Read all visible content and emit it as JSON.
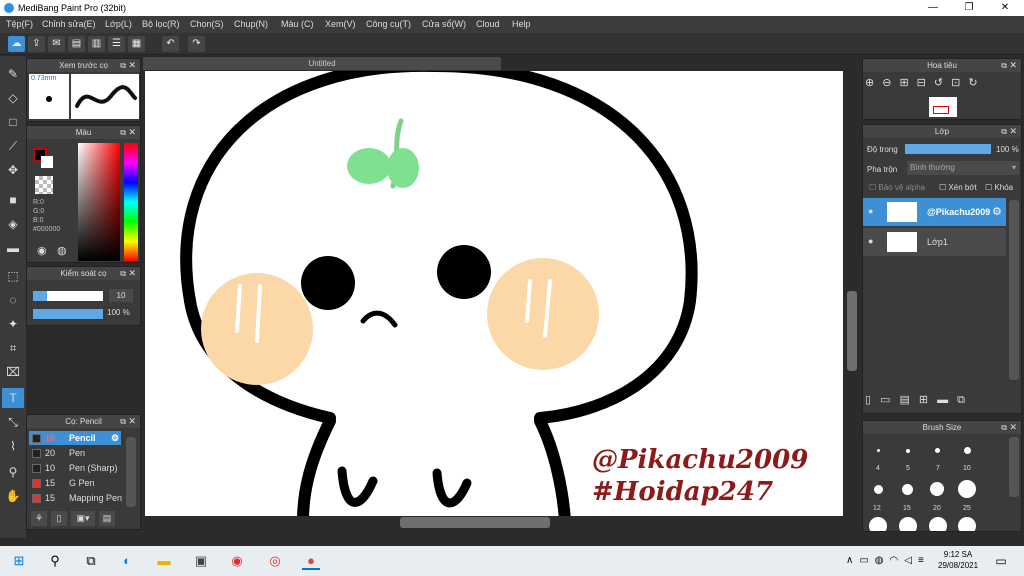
{
  "window": {
    "title": "MediBang Paint Pro (32bit)",
    "min": "—",
    "max": "❐",
    "close": "✕"
  },
  "menu": [
    "Tệp(F)",
    "Chỉnh sửa(E)",
    "Lớp(L)",
    "Bộ lọc(R)",
    "Chọn(S)",
    "Chụp(N)",
    "Màu (C)",
    "Xem(V)",
    "Công cụ(T)",
    "Cửa sổ(W)",
    "Cloud",
    "Help"
  ],
  "toolbar": {
    "icons": [
      "cloud-icon",
      "upload-icon",
      "chat-icon",
      "comment-icon",
      "page-icon",
      "list-icon",
      "grid-icon",
      "undo-icon",
      "redo-icon"
    ]
  },
  "preview_panel": {
    "title": "Xem trước cọ",
    "size": "0.73mm"
  },
  "color_panel": {
    "title": "Màu",
    "r": "R:0",
    "g": "G:0",
    "b": "B:0",
    "hex": "#000000",
    "primary": "#000000",
    "secondary": "#ffffff"
  },
  "control_panel": {
    "title": "Kiểm soát cọ",
    "size_value": "10",
    "opacity_value": "100 %",
    "size_fraction": 1.0,
    "opacity_fraction": 1.0
  },
  "brush_panel": {
    "title": "Cọ: Pencil",
    "brushes": [
      {
        "size": "10",
        "name": "Pencil",
        "color": "#222222",
        "selected": true
      },
      {
        "size": "20",
        "name": "Pen",
        "color": "#222222",
        "selected": false
      },
      {
        "size": "10",
        "name": "Pen (Sharp)",
        "color": "#222222",
        "selected": false
      },
      {
        "size": "15",
        "name": "G Pen",
        "color": "#e83030",
        "selected": false
      },
      {
        "size": "15",
        "name": "Mapping Pen",
        "color": "#e83030",
        "selected": false
      }
    ]
  },
  "document": {
    "tab": "Untitled"
  },
  "artwork": {
    "text1": "@Pikachu2009",
    "text2": "#Hoidap247",
    "text_color": "#8b1a1a"
  },
  "navigator": {
    "title": "Hoa tiêu"
  },
  "layers": {
    "title": "Lớp",
    "opacity_label": "Độ trong",
    "opacity_value": "100 %",
    "blend_label": "Pha trộn",
    "blend_value": "Bình thường",
    "protect_alpha": "Bảo vệ alpha",
    "clip": "Xén bớt",
    "lock": "Khóa",
    "items": [
      {
        "name": "@Pikachu2009",
        "selected": true
      },
      {
        "name": "Lớp1",
        "selected": false
      }
    ]
  },
  "brush_size": {
    "title": "Brush Size",
    "sizes": [
      "4",
      "5",
      "7",
      "10",
      "12",
      "15",
      "20",
      "25"
    ]
  },
  "taskbar": {
    "time": "9:12 SA",
    "date": "29/08/2021"
  }
}
